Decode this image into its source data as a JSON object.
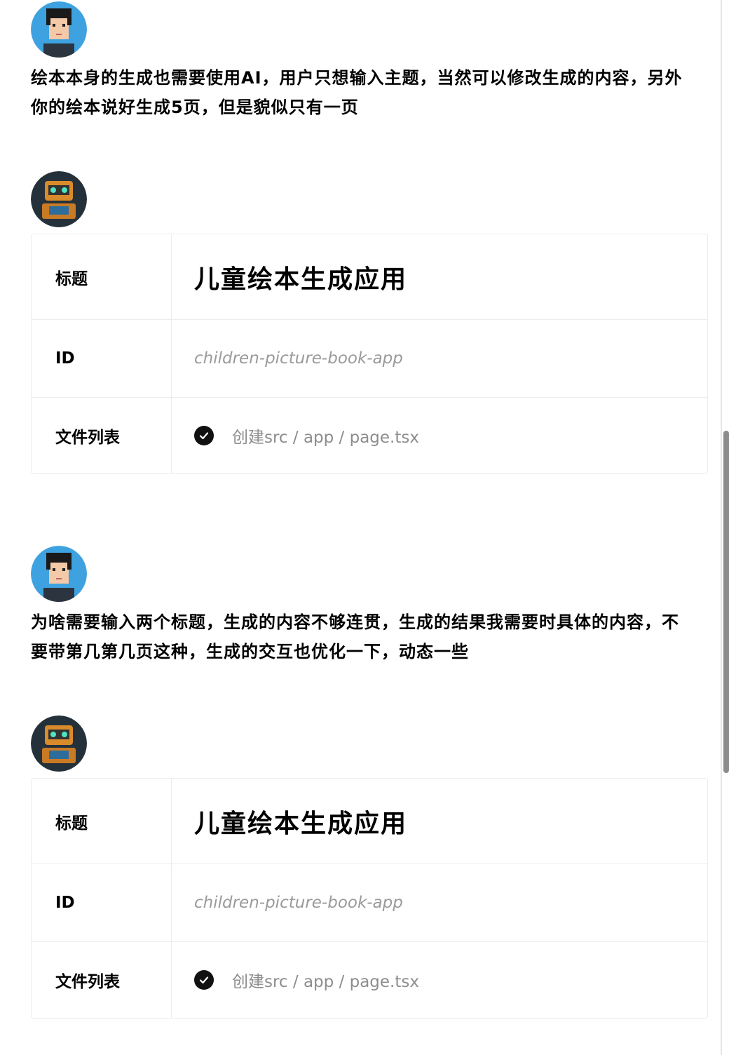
{
  "messages": [
    {
      "role": "user",
      "avatar_icon": "user-avatar-icon",
      "text": "绘本本身的生成也需要使用AI，用户只想输入主题，当然可以修改生成的内容，另外你的绘本说好生成5页，但是貌似只有一页"
    },
    {
      "role": "assistant",
      "avatar_icon": "robot-avatar-icon",
      "card": {
        "title_label": "标题",
        "title_value": "儿童绘本生成应用",
        "id_label": "ID",
        "id_value": "children-picture-book-app",
        "files_label": "文件列表",
        "file_status_icon": "check-circle-icon",
        "file_text": "创建src / app / page.tsx"
      }
    },
    {
      "role": "user",
      "avatar_icon": "user-avatar-icon",
      "text": "为啥需要输入两个标题，生成的内容不够连贯，生成的结果我需要时具体的内容，不要带第几第几页这种，生成的交互也优化一下，动态一些"
    },
    {
      "role": "assistant",
      "avatar_icon": "robot-avatar-icon",
      "card": {
        "title_label": "标题",
        "title_value": "儿童绘本生成应用",
        "id_label": "ID",
        "id_value": "children-picture-book-app",
        "files_label": "文件列表",
        "file_status_icon": "check-circle-icon",
        "file_text": "创建src / app / page.tsx"
      }
    }
  ]
}
